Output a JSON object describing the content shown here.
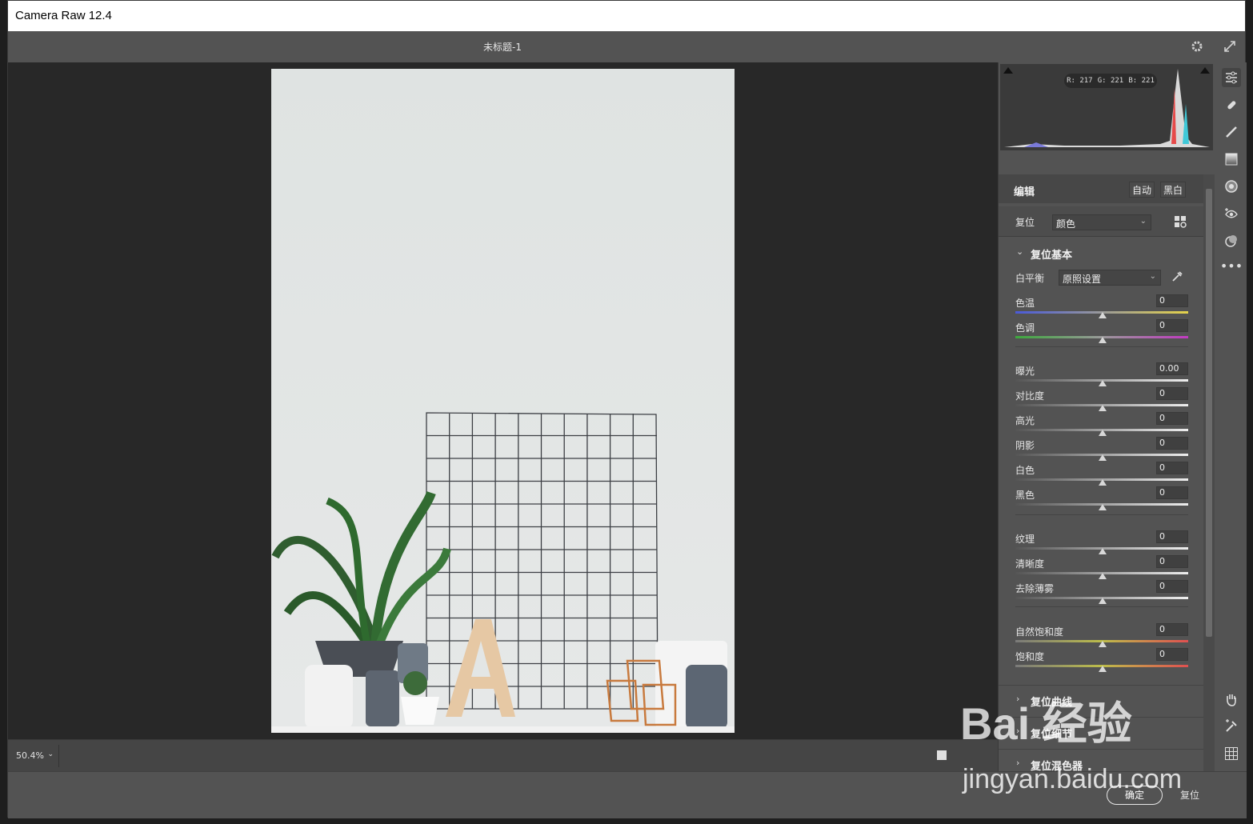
{
  "window": {
    "title": "Camera Raw 12.4"
  },
  "topbar": {
    "doc_title": "未标题-1"
  },
  "histogram": {
    "r": "R: 217",
    "g": "G: 221",
    "b": "B: 221"
  },
  "edit": {
    "label": "编辑",
    "auto": "自动",
    "bw": "黑白"
  },
  "profile": {
    "label": "复位",
    "value": "颜色"
  },
  "basic": {
    "title": "复位基本",
    "white_balance_label": "白平衡",
    "white_balance_value": "原照设置",
    "sliders": [
      {
        "label": "色温",
        "value": "0",
        "track": "linear-gradient(90deg,#4a5ad8,#9a9a9a,#e4d24a)"
      },
      {
        "label": "色调",
        "value": "0",
        "track": "linear-gradient(90deg,#3da83d,#9a9a9a,#c23ac2)"
      },
      {
        "label": "曝光",
        "value": "0.00",
        "track": "linear-gradient(90deg,#555,#eee)"
      },
      {
        "label": "对比度",
        "value": "0",
        "track": "linear-gradient(90deg,#555,#eee)"
      },
      {
        "label": "高光",
        "value": "0",
        "track": "linear-gradient(90deg,#555,#eee)"
      },
      {
        "label": "阴影",
        "value": "0",
        "track": "linear-gradient(90deg,#555,#eee)"
      },
      {
        "label": "白色",
        "value": "0",
        "track": "linear-gradient(90deg,#555,#eee)"
      },
      {
        "label": "黑色",
        "value": "0",
        "track": "linear-gradient(90deg,#555,#eee)"
      },
      {
        "label": "纹理",
        "value": "0",
        "track": "linear-gradient(90deg,#555,#eee)"
      },
      {
        "label": "清晰度",
        "value": "0",
        "track": "linear-gradient(90deg,#555,#eee)"
      },
      {
        "label": "去除薄雾",
        "value": "0",
        "track": "linear-gradient(90deg,#555,#eee)"
      },
      {
        "label": "自然饱和度",
        "value": "0",
        "track": "linear-gradient(90deg,#7a7a7a,#bdbd4a,#e05050)"
      },
      {
        "label": "饱和度",
        "value": "0",
        "track": "linear-gradient(90deg,#7a7a7a,#bdbd4a,#e05050)"
      }
    ]
  },
  "collapsed_sections": [
    "复位曲线",
    "复位细节",
    "复位混色器"
  ],
  "zoom": {
    "value": "50.4%"
  },
  "footer": {
    "ok": "确定",
    "reset": "复位"
  },
  "watermark": {
    "logo": "Bai 经验",
    "url": "jingyan.baidu.com"
  }
}
